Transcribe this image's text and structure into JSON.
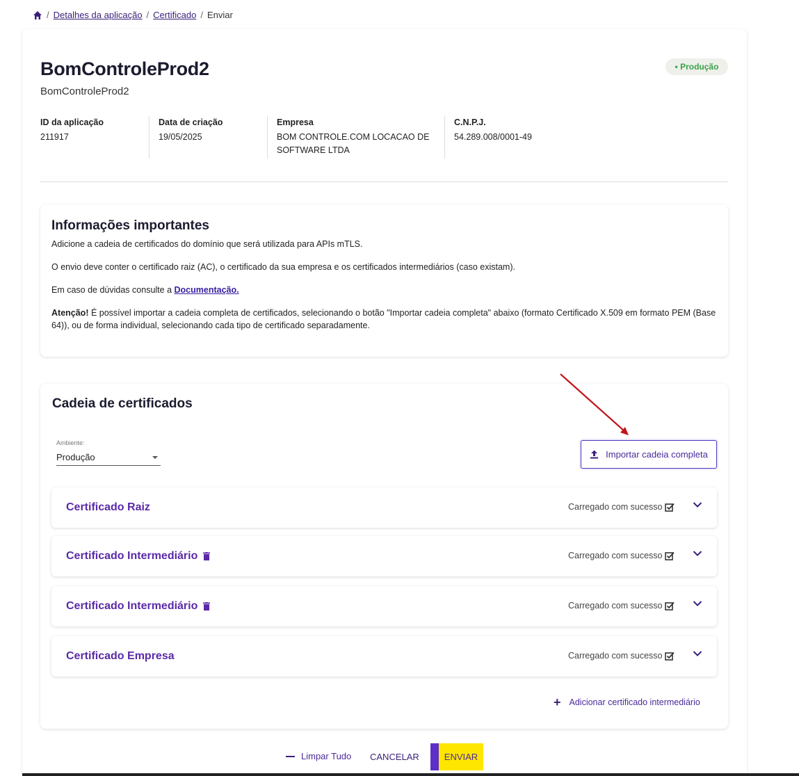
{
  "breadcrumb": {
    "items": [
      "Detalhes da aplicação",
      "Certificado"
    ],
    "current": "Enviar",
    "separator": "/"
  },
  "app": {
    "title": "BomControleProd2",
    "subtitle": "BomControleProd2",
    "environment_badge": "• Produção"
  },
  "meta": {
    "id": {
      "label": "ID da aplicação",
      "value": "211917"
    },
    "created": {
      "label": "Data de criação",
      "value": "19/05/2025"
    },
    "company": {
      "label": "Empresa",
      "value_line1": "BOM CONTROLE.COM LOCACAO DE",
      "value_line2": "SOFTWARE LTDA"
    },
    "cnpj": {
      "label": "C.N.P.J.",
      "value": "54.289.008/0001-49"
    }
  },
  "info": {
    "title": "Informações importantes",
    "p1": "Adicione a cadeia de certificados do domínio que será utilizada para APIs mTLS.",
    "p2": "O envio deve conter o certificado raiz (AC), o certificado da sua empresa e os certificados intermediários (caso existam).",
    "p3_prefix": "Em caso de dúvidas consulte a ",
    "p3_link": "Documentação.",
    "p4_bold": "Atenção!",
    "p4_text": " É possível importar a cadeia completa de certificados, selecionando o botão \"Importar cadeia completa\" abaixo (formato Certificado X.509 em formato PEM (Base 64)), ou de forma individual, selecionando cada tipo de certificado separadamente."
  },
  "chain": {
    "title": "Cadeia de certificados",
    "ambiente_label": "Ambiente:",
    "ambiente_value": "Produção",
    "import_label": "Importar cadeia completa",
    "certs": [
      {
        "name": "Certificado Raiz",
        "status": "Carregado com sucesso",
        "deletable": false
      },
      {
        "name": "Certificado Intermediário",
        "status": "Carregado com sucesso",
        "deletable": true
      },
      {
        "name": "Certificado Intermediário",
        "status": "Carregado com sucesso",
        "deletable": true
      },
      {
        "name": "Certificado Empresa",
        "status": "Carregado com sucesso",
        "deletable": false
      }
    ],
    "add_label": "Adicionar certificado intermediário"
  },
  "footer": {
    "clear_label": "Limpar Tudo",
    "cancel_label": "CANCELAR",
    "send_label": "ENVIAR"
  },
  "colors": {
    "brand_purple": "#5a2aa8",
    "send_yellow": "#ffe600",
    "badge_green": "#3aa34a",
    "annotation_red": "#c0161b"
  }
}
